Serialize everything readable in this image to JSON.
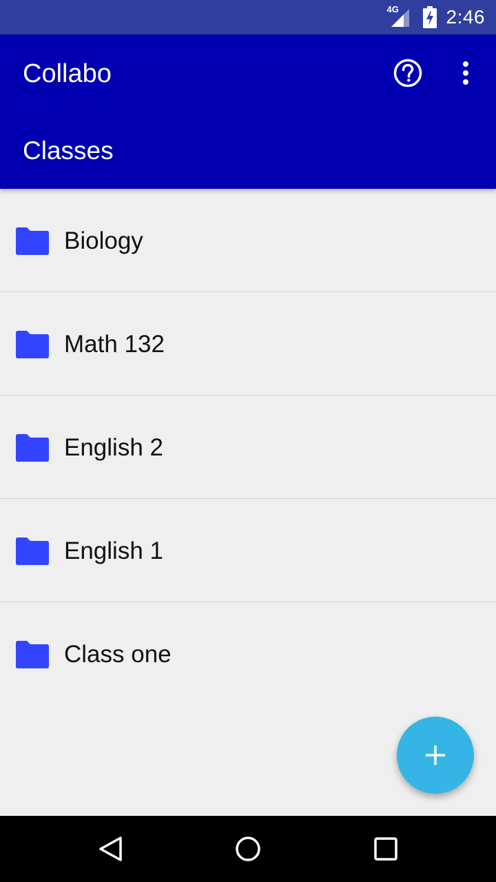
{
  "status_bar": {
    "network": "4G",
    "time": "2:46",
    "icons": [
      "signal-icon",
      "battery-charging-icon"
    ]
  },
  "app_bar": {
    "title": "Collabo",
    "section_title": "Classes",
    "actions": [
      "help-icon",
      "overflow-menu-icon"
    ]
  },
  "classes": [
    {
      "label": "Biology",
      "icon": "folder-icon"
    },
    {
      "label": "Math 132",
      "icon": "folder-icon"
    },
    {
      "label": "English 2",
      "icon": "folder-icon"
    },
    {
      "label": "English 1",
      "icon": "folder-icon"
    },
    {
      "label": "Class one",
      "icon": "folder-icon"
    }
  ],
  "fab": {
    "icon": "add-icon"
  },
  "nav_bar": {
    "buttons": [
      "back-icon",
      "home-icon",
      "recents-icon"
    ]
  },
  "colors": {
    "status_bar": "#303f9f",
    "app_bar": "#0000b0",
    "folder": "#3344ff",
    "fab": "#35b5e5",
    "background": "#efefef"
  }
}
